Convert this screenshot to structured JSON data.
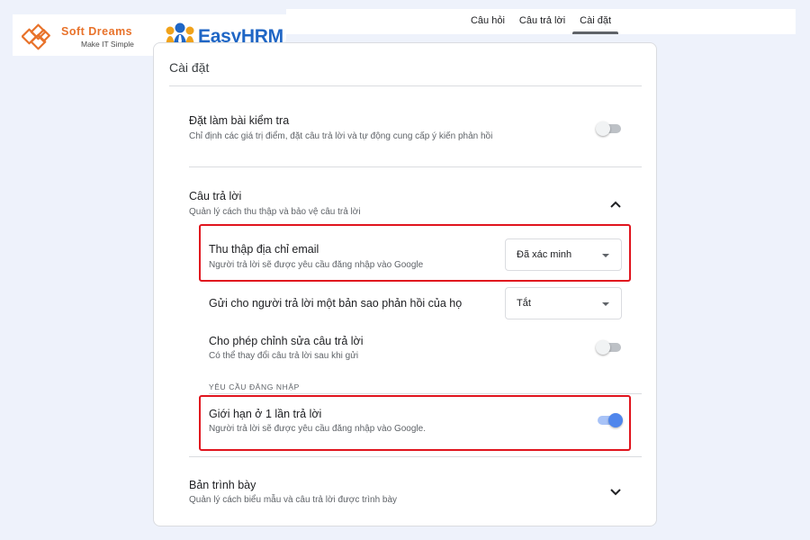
{
  "tabs": [
    {
      "label": "Câu hỏi",
      "active": false
    },
    {
      "label": "Câu trả lời",
      "active": false
    },
    {
      "label": "Cài đặt",
      "active": true
    }
  ],
  "logos": {
    "softdreams_name": "Soft Dreams",
    "softdreams_tagline": "Make IT Simple",
    "easyhrm_name": "EasyHRM",
    "softdreams_color": "#e8722a",
    "easyhrm_color": "#1f66c5"
  },
  "card": {
    "title": "Cài đặt",
    "quiz": {
      "title": "Đặt làm bài kiểm tra",
      "desc": "Chỉ định các giá trị điểm, đặt câu trả lời và tự động cung cấp ý kiến phản hồi",
      "enabled": false
    },
    "responses": {
      "title": "Câu trả lời",
      "desc": "Quản lý cách thu thập và bảo vệ câu trả lời",
      "expanded": true,
      "collect_email": {
        "title": "Thu thập địa chỉ email",
        "desc": "Người trả lời sẽ được yêu cầu đăng nhập vào Google",
        "value": "Đã xác minh"
      },
      "send_copy": {
        "title": "Gửi cho người trả lời một bản sao phản hồi của họ",
        "value": "Tắt"
      },
      "allow_edit": {
        "title": "Cho phép chỉnh sửa câu trả lời",
        "desc": "Có thể thay đổi câu trả lời sau khi gửi",
        "enabled": false
      },
      "login_required_label": "YÊU CẦU ĐĂNG NHẬP",
      "limit_one": {
        "title": "Giới hạn ở 1 lần trả lời",
        "desc": "Người trả lời sẽ được yêu cầu đăng nhập vào Google.",
        "enabled": true
      }
    },
    "presentation": {
      "title": "Bản trình bày",
      "desc": "Quản lý cách biểu mẫu và câu trả lời được trình bày",
      "expanded": false
    }
  },
  "colors": {
    "highlight": "#e0141e",
    "toggle_on": "#4f86ec",
    "background": "#eef2fb"
  },
  "icons": [
    "chevron-up-icon",
    "chevron-down-icon",
    "dropdown-caret-icon",
    "softdreams-logo-icon",
    "easyhrm-logo-icon"
  ]
}
